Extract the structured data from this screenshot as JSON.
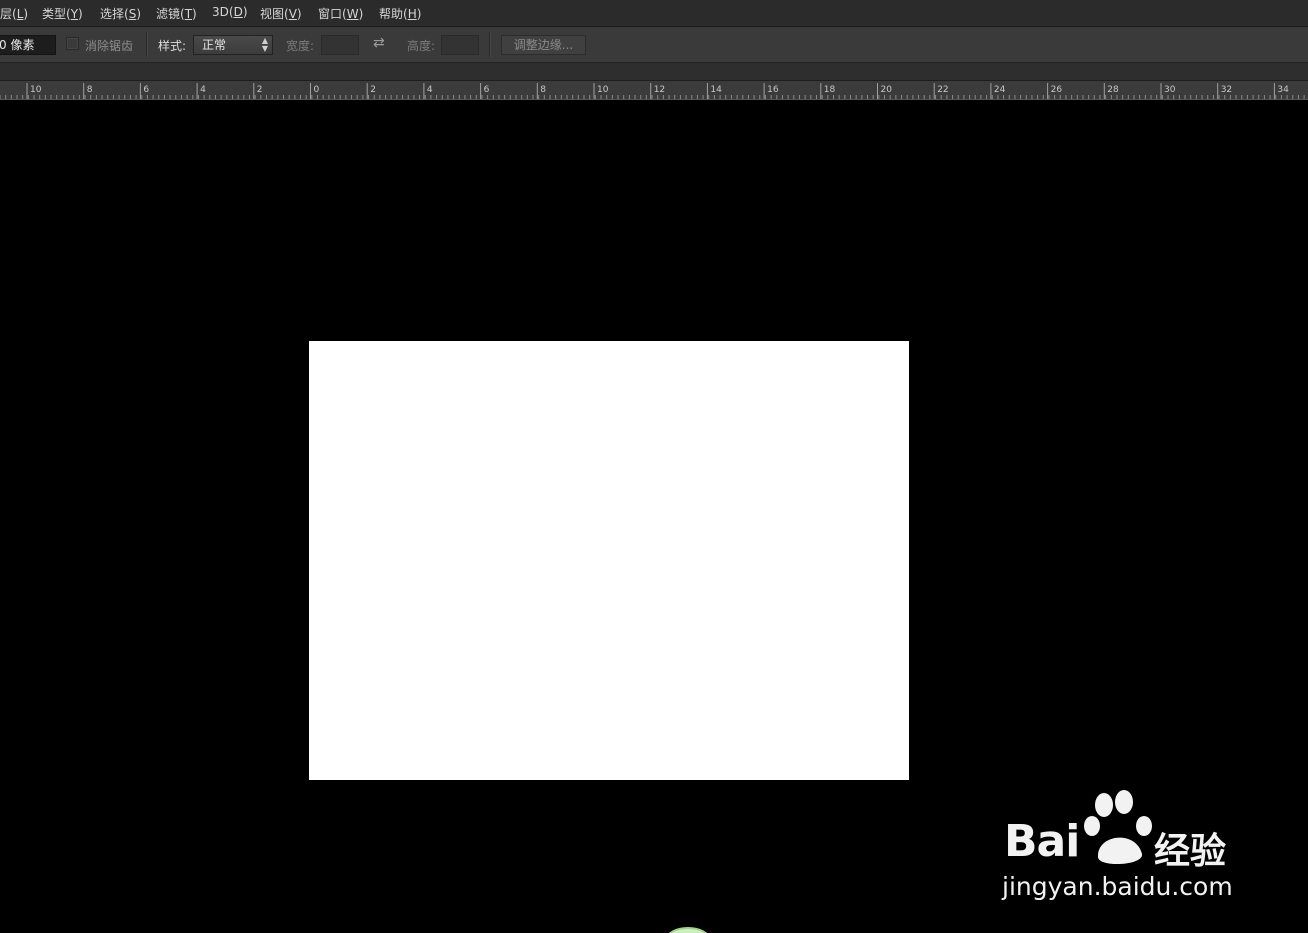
{
  "menubar": {
    "items": [
      {
        "text": "层(",
        "key": "L",
        "close": ")"
      },
      {
        "text": "类型(",
        "key": "Y",
        "close": ")"
      },
      {
        "text": "选择(",
        "key": "S",
        "close": ")"
      },
      {
        "text": "滤镜(",
        "key": "T",
        "close": ")"
      },
      {
        "text": "3D(",
        "key": "D",
        "close": ")"
      },
      {
        "text": "视图(",
        "key": "V",
        "close": ")"
      },
      {
        "text": "窗口(",
        "key": "W",
        "close": ")"
      },
      {
        "text": "帮助(",
        "key": "H",
        "close": ")"
      }
    ]
  },
  "options": {
    "feather_value": "0 像素",
    "antialias_label": "消除锯齿",
    "antialias_checked": false,
    "style_label": "样式:",
    "style_value": "正常",
    "width_label": "宽度:",
    "height_label": "高度:",
    "refine_edge_label": "调整边缘..."
  },
  "ruler": {
    "ticks": [
      "10",
      "8",
      "6",
      "4",
      "2",
      "0",
      "2",
      "4",
      "6",
      "8",
      "10",
      "12",
      "14",
      "16",
      "18",
      "20",
      "22",
      "24",
      "26",
      "28",
      "30",
      "32",
      "34"
    ]
  },
  "watermark": {
    "brand": "Bai",
    "brand_du": "du",
    "brand_jy": "经验",
    "url": "jingyan.baidu.com"
  },
  "colors": {
    "background": "#000000",
    "document": "#ffffff",
    "menubar": "#2b2b2b",
    "optionsbar": "#3a3a3a"
  }
}
